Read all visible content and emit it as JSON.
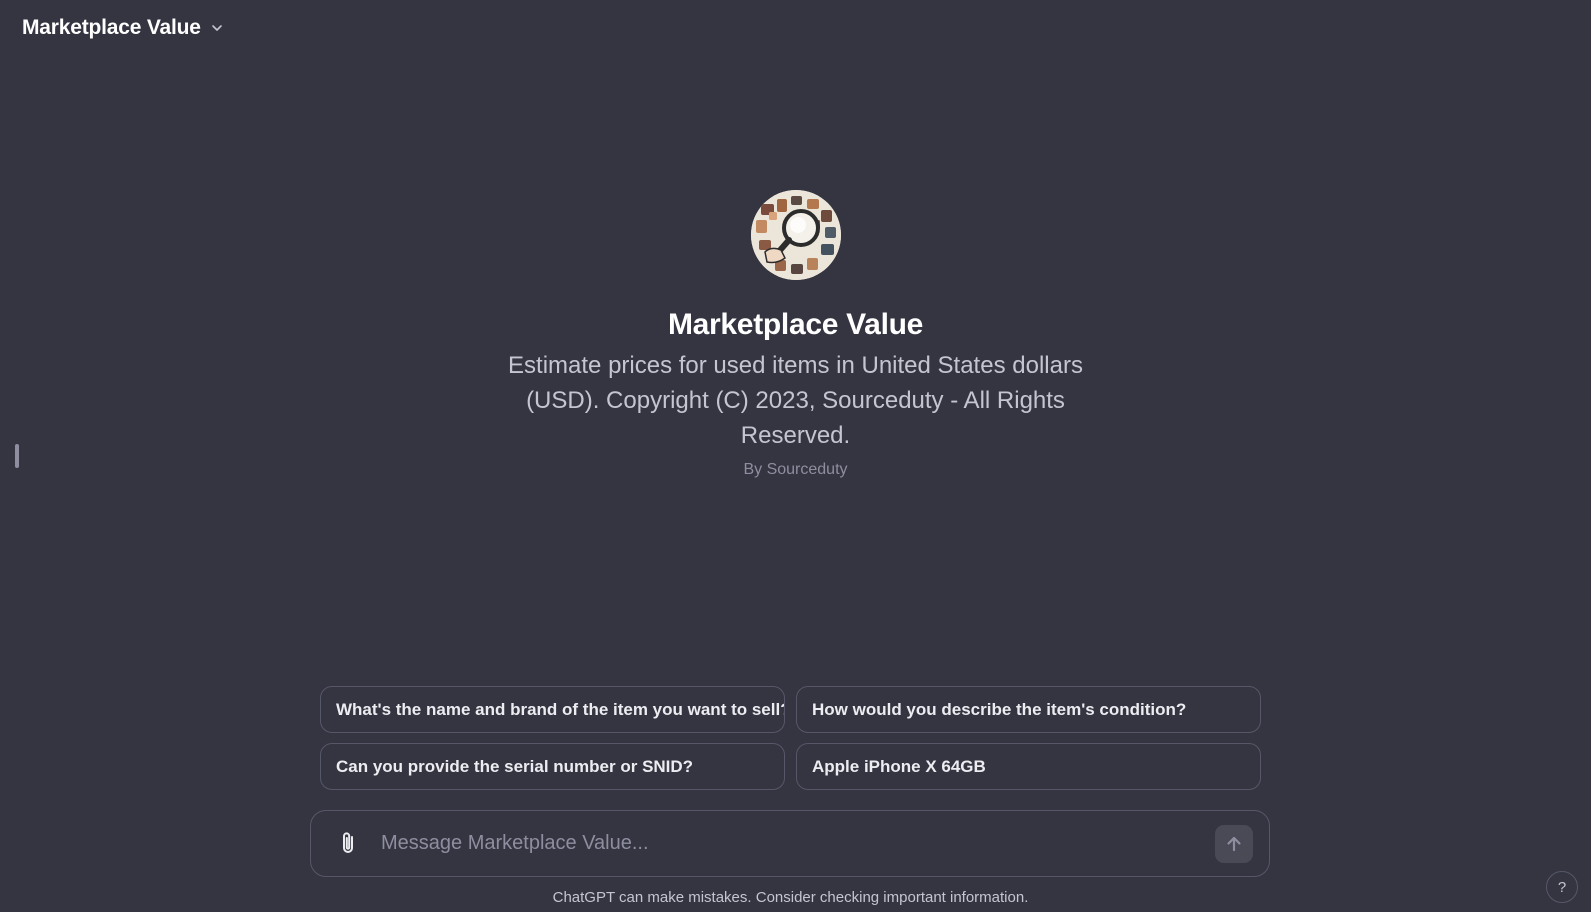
{
  "header": {
    "title": "Marketplace Value",
    "dropdown_icon": "chevron-down-icon"
  },
  "gpt": {
    "avatar_icon": "magnifying-glass-collage-avatar",
    "name": "Marketplace Value",
    "description": "Estimate prices for used items in United States dollars (USD). Copyright (C) 2023, Sourceduty - All Rights Reserved.",
    "author": "By Sourceduty"
  },
  "starters": [
    "What's the name and brand of the item you want to sell?",
    "How would you describe the item's condition?",
    "Can you provide the serial number or SNID?",
    "Apple iPhone X 64GB"
  ],
  "composer": {
    "placeholder": "Message Marketplace Value...",
    "value": "",
    "attach_icon": "paperclip-icon",
    "send_icon": "arrow-up-icon"
  },
  "footer": {
    "disclaimer": "ChatGPT can make mistakes. Consider checking important information.",
    "help_label": "?"
  },
  "colors": {
    "background": "#343541",
    "border": "#565869",
    "text_primary": "#ececf1",
    "text_secondary": "#c5c5d2",
    "text_muted": "#8e8ea0",
    "send_button": "#494a56"
  }
}
